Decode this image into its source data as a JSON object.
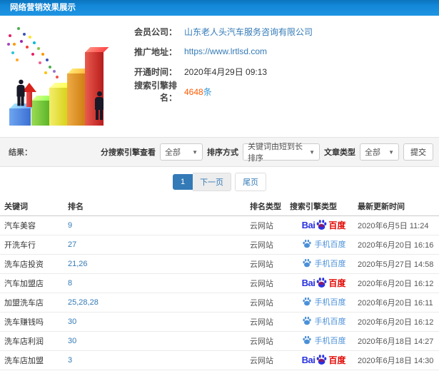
{
  "header": {
    "title": "网络营销效果展示"
  },
  "info": {
    "fields": [
      {
        "label": "会员公司：",
        "value": "山东老人头汽车服务咨询有限公司"
      },
      {
        "label": "推广地址：",
        "value": "https://www.lrtlsd.com"
      },
      {
        "label": "开通时间：",
        "value": "2020年4月29日 09:13"
      },
      {
        "label": "搜索引擎排名：",
        "value": "4648",
        "suffix": "条"
      }
    ]
  },
  "filters": {
    "result_label": "结果：",
    "engine_filter_label": "分搜索引擎查看",
    "engine_filter_value": "全部",
    "sort_label": "排序方式",
    "sort_value": "关键词由短到长排序",
    "article_type_label": "文章类型",
    "article_type_value": "全部",
    "submit_label": "提交"
  },
  "pagination": {
    "current": "1",
    "next": "下一页",
    "last": "尾页"
  },
  "icons": {
    "caret_down": "▼"
  },
  "colors": {
    "header_blue": "#1287d8",
    "link_blue": "#337ab7",
    "highlight_orange": "#ff5a00",
    "baidu_blue": "#2932e1",
    "baidu_red": "#e10601",
    "mobile_baidu_blue": "#4a90d9"
  },
  "engines": {
    "baidu": {
      "latin": "Bai",
      "du": "du",
      "cn": "百度"
    },
    "mobile-baidu": {
      "name": "手机百度"
    }
  },
  "table": {
    "headers": [
      "关键词",
      "排名",
      "排名类型",
      "搜索引擎类型",
      "最新更新时间"
    ],
    "rows": [
      {
        "keyword": "汽车美容",
        "rank": "9",
        "rank_type": "云网站",
        "engine": "baidu",
        "time": "2020年6月5日 11:24"
      },
      {
        "keyword": "开洗车行",
        "rank": "27",
        "rank_type": "云网站",
        "engine": "mobile-baidu",
        "time": "2020年6月20日 16:16"
      },
      {
        "keyword": "洗车店投资",
        "rank": "21,26",
        "rank_type": "云网站",
        "engine": "mobile-baidu",
        "time": "2020年5月27日 14:58"
      },
      {
        "keyword": "汽车加盟店",
        "rank": "8",
        "rank_type": "云网站",
        "engine": "baidu",
        "time": "2020年6月20日 16:12"
      },
      {
        "keyword": "加盟洗车店",
        "rank": "25,28,28",
        "rank_type": "云网站",
        "engine": "mobile-baidu",
        "time": "2020年6月20日 16:11"
      },
      {
        "keyword": "洗车赚钱吗",
        "rank": "30",
        "rank_type": "云网站",
        "engine": "mobile-baidu",
        "time": "2020年6月20日 16:12"
      },
      {
        "keyword": "洗车店利润",
        "rank": "30",
        "rank_type": "云网站",
        "engine": "mobile-baidu",
        "time": "2020年6月18日 14:27"
      },
      {
        "keyword": "洗车店加盟",
        "rank": "3",
        "rank_type": "云网站",
        "engine": "baidu",
        "time": "2020年6月18日 14:30"
      }
    ]
  }
}
